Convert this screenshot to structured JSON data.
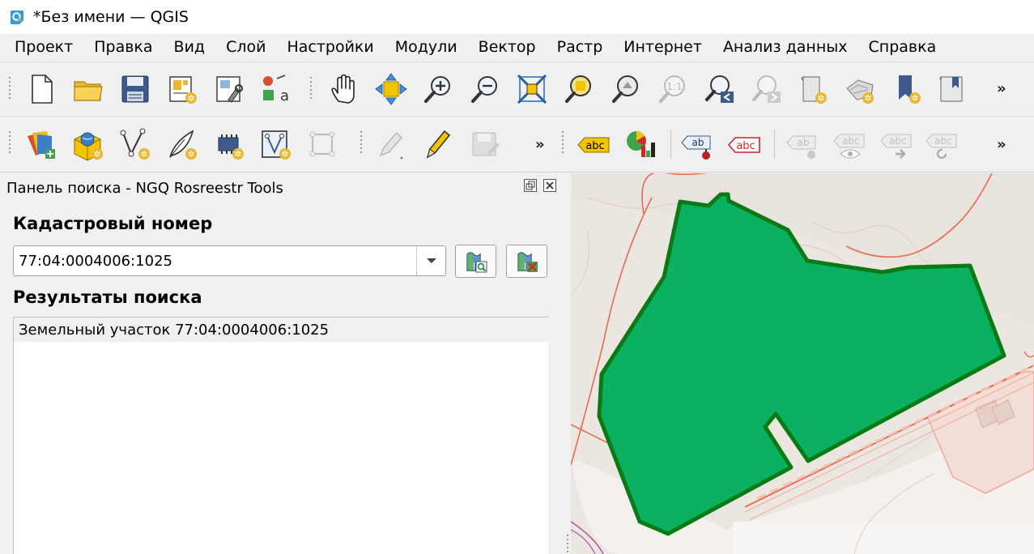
{
  "window": {
    "title": "*Без имени — QGIS"
  },
  "menu": [
    "Проект",
    "Правка",
    "Вид",
    "Слой",
    "Настройки",
    "Модули",
    "Вектор",
    "Растр",
    "Интернет",
    "Анализ данных",
    "Справка"
  ],
  "toolbar": {
    "overflow": "»"
  },
  "panel": {
    "title": "Панель поиска - NGQ Rosreestr Tools",
    "cadastral_label": "Кадастровый номер",
    "cadastral_value": "77:04:0004006:1025",
    "results_label": "Результаты поиска",
    "results": [
      "Земельный участок 77:04:0004006:1025"
    ]
  },
  "label_tools": {
    "abc": "abc",
    "ab": "ab"
  },
  "colors": {
    "parcel_fill": "#0bb061",
    "parcel_stroke": "#0a7a14",
    "boundary": "#e86a50",
    "accent": "#f5c400"
  }
}
